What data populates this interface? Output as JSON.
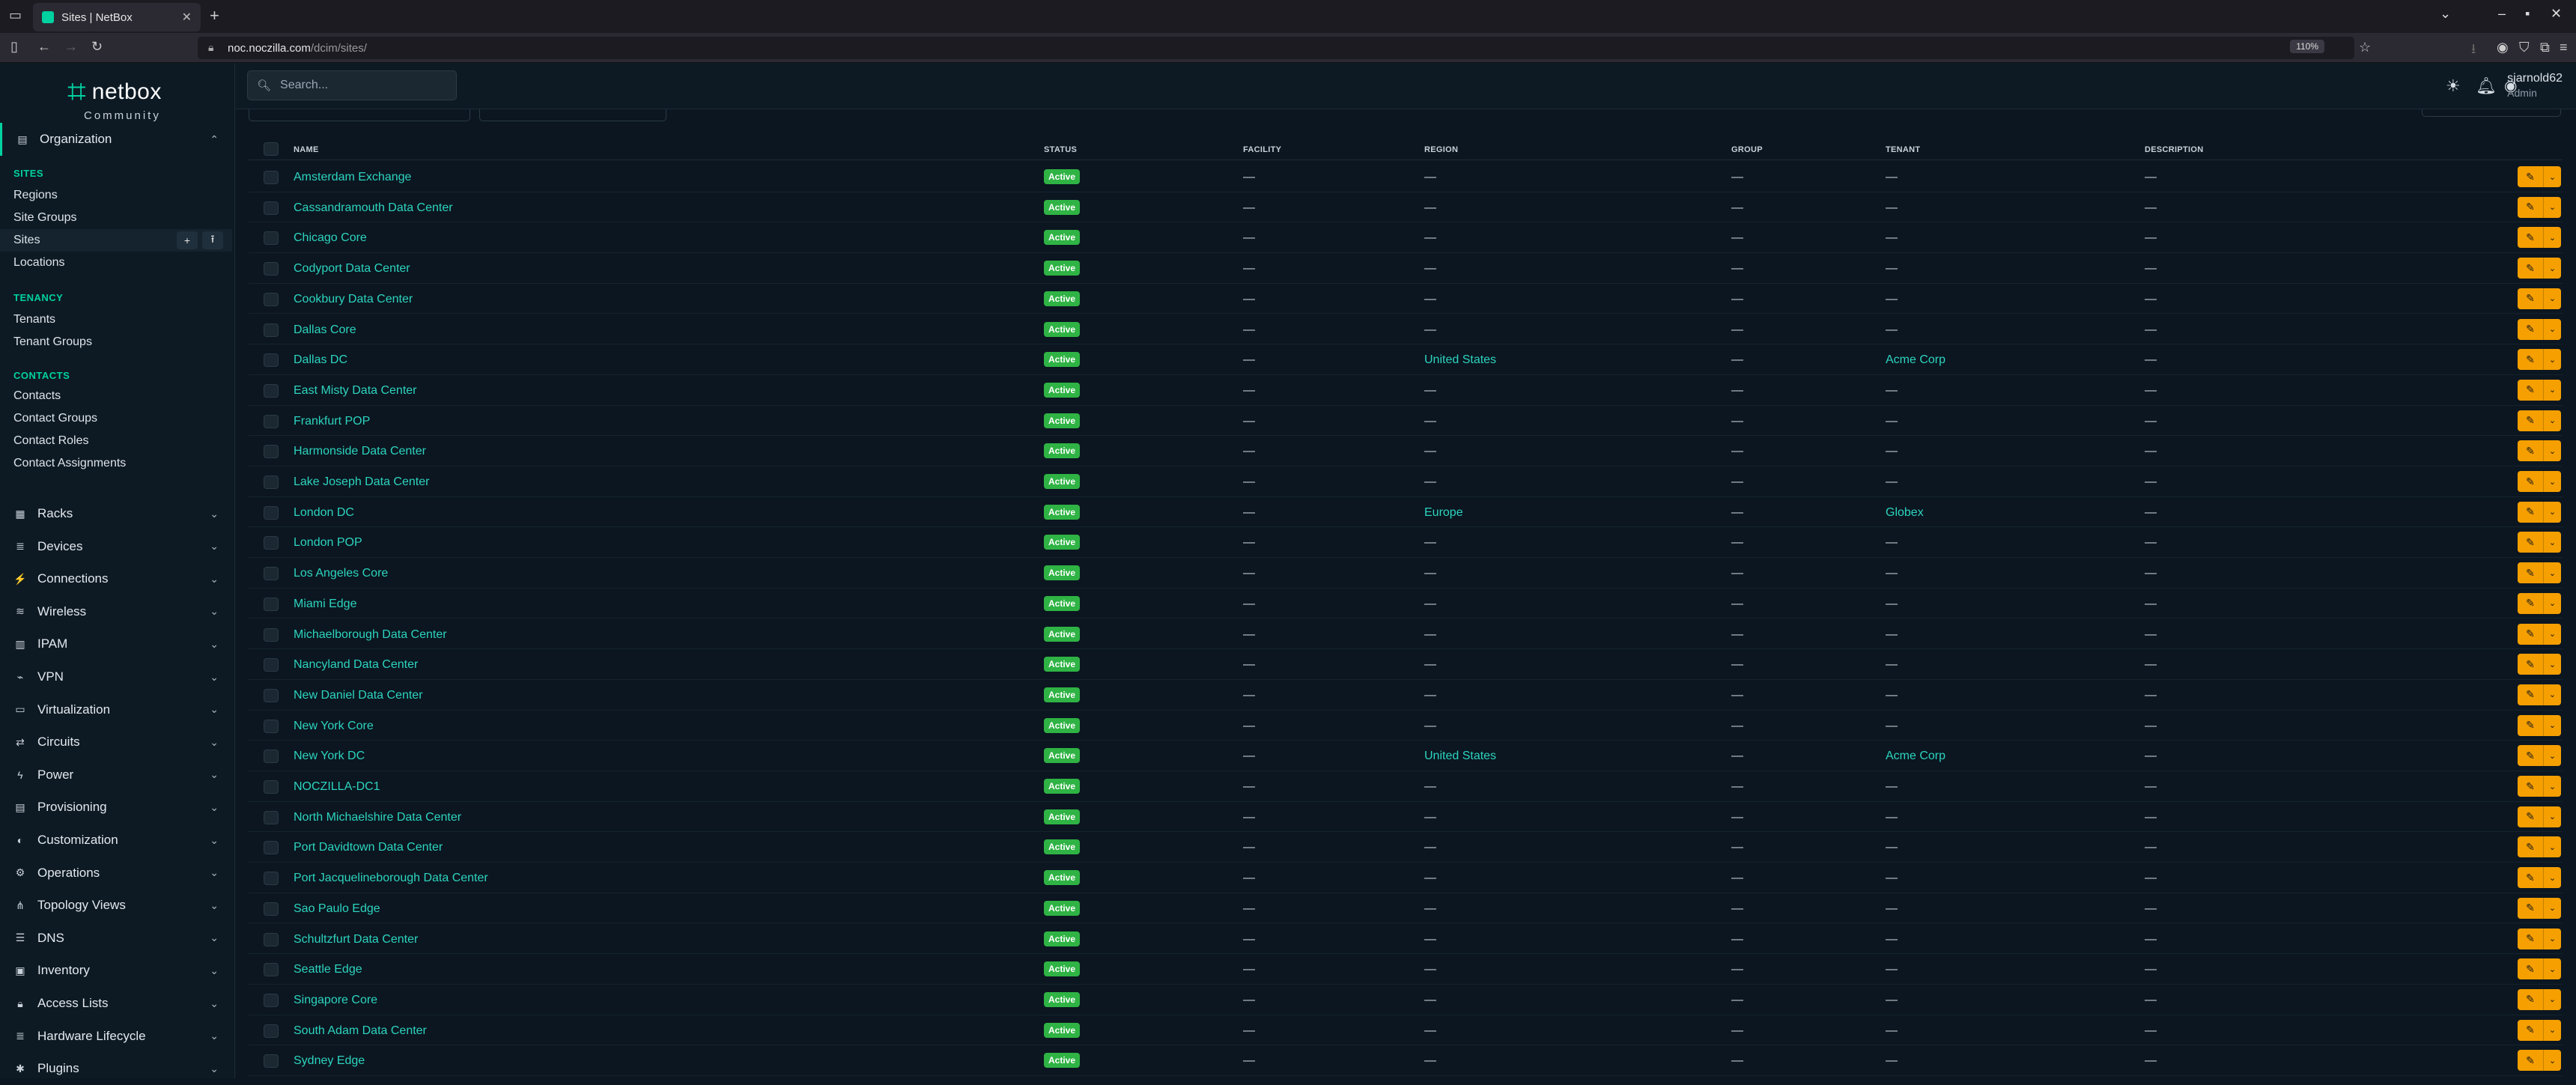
{
  "browser": {
    "tab_title": "Sites | NetBox",
    "url_host": "noc.noczilla.com",
    "url_path": "/dcim/sites/",
    "zoom": "110%"
  },
  "brand": {
    "name": "netbox",
    "edition": "Community"
  },
  "search": {
    "placeholder": "Search..."
  },
  "user": {
    "username": "sjarnold62",
    "role": "Admin"
  },
  "sidebar": {
    "organization": "Organization",
    "groups": [
      {
        "heading": "SITES",
        "items": [
          "Regions",
          "Site Groups",
          "Sites",
          "Locations"
        ]
      },
      {
        "heading": "TENANCY",
        "items": [
          "Tenants",
          "Tenant Groups"
        ]
      },
      {
        "heading": "CONTACTS",
        "items": [
          "Contacts",
          "Contact Groups",
          "Contact Roles",
          "Contact Assignments"
        ]
      }
    ],
    "selected_add": "+",
    "selected_import": "⭱",
    "sections": [
      {
        "label": "Racks",
        "icon": "rack-icon"
      },
      {
        "label": "Devices",
        "icon": "server-icon"
      },
      {
        "label": "Connections",
        "icon": "plug-icon"
      },
      {
        "label": "Wireless",
        "icon": "wifi-icon"
      },
      {
        "label": "IPAM",
        "icon": "counter-icon"
      },
      {
        "label": "VPN",
        "icon": "tunnel-icon"
      },
      {
        "label": "Virtualization",
        "icon": "monitor-icon"
      },
      {
        "label": "Circuits",
        "icon": "transit-icon"
      },
      {
        "label": "Power",
        "icon": "power-icon"
      },
      {
        "label": "Provisioning",
        "icon": "file-icon"
      },
      {
        "label": "Customization",
        "icon": "palette-icon"
      },
      {
        "label": "Operations",
        "icon": "cogs-icon"
      },
      {
        "label": "Topology Views",
        "icon": "topology-icon"
      },
      {
        "label": "DNS",
        "icon": "dns-icon"
      },
      {
        "label": "Inventory",
        "icon": "inventory-icon"
      },
      {
        "label": "Access Lists",
        "icon": "lock-icon"
      },
      {
        "label": "Hardware Lifecycle",
        "icon": "list-icon"
      },
      {
        "label": "Plugins",
        "icon": "puzzle-icon"
      }
    ]
  },
  "table": {
    "columns": [
      "NAME",
      "STATUS",
      "FACILITY",
      "REGION",
      "GROUP",
      "TENANT",
      "DESCRIPTION"
    ],
    "empty": "—",
    "rows": [
      {
        "name": "Amsterdam Exchange",
        "status": "Active",
        "region": "—",
        "tenant": "—"
      },
      {
        "name": "Cassandramouth Data Center",
        "status": "Active",
        "region": "—",
        "tenant": "—"
      },
      {
        "name": "Chicago Core",
        "status": "Active",
        "region": "—",
        "tenant": "—"
      },
      {
        "name": "Codyport Data Center",
        "status": "Active",
        "region": "—",
        "tenant": "—"
      },
      {
        "name": "Cookbury Data Center",
        "status": "Active",
        "region": "—",
        "tenant": "—"
      },
      {
        "name": "Dallas Core",
        "status": "Active",
        "region": "—",
        "tenant": "—"
      },
      {
        "name": "Dallas DC",
        "status": "Active",
        "region": "United States",
        "tenant": "Acme Corp"
      },
      {
        "name": "East Misty Data Center",
        "status": "Active",
        "region": "—",
        "tenant": "—"
      },
      {
        "name": "Frankfurt POP",
        "status": "Active",
        "region": "—",
        "tenant": "—"
      },
      {
        "name": "Harmonside Data Center",
        "status": "Active",
        "region": "—",
        "tenant": "—"
      },
      {
        "name": "Lake Joseph Data Center",
        "status": "Active",
        "region": "—",
        "tenant": "—"
      },
      {
        "name": "London DC",
        "status": "Active",
        "region": "Europe",
        "tenant": "Globex"
      },
      {
        "name": "London POP",
        "status": "Active",
        "region": "—",
        "tenant": "—"
      },
      {
        "name": "Los Angeles Core",
        "status": "Active",
        "region": "—",
        "tenant": "—"
      },
      {
        "name": "Miami Edge",
        "status": "Active",
        "region": "—",
        "tenant": "—"
      },
      {
        "name": "Michaelborough Data Center",
        "status": "Active",
        "region": "—",
        "tenant": "—"
      },
      {
        "name": "Nancyland Data Center",
        "status": "Active",
        "region": "—",
        "tenant": "—"
      },
      {
        "name": "New Daniel Data Center",
        "status": "Active",
        "region": "—",
        "tenant": "—"
      },
      {
        "name": "New York Core",
        "status": "Active",
        "region": "—",
        "tenant": "—"
      },
      {
        "name": "New York DC",
        "status": "Active",
        "region": "United States",
        "tenant": "Acme Corp"
      },
      {
        "name": "NOCZILLA-DC1",
        "status": "Active",
        "region": "—",
        "tenant": "—"
      },
      {
        "name": "North Michaelshire Data Center",
        "status": "Active",
        "region": "—",
        "tenant": "—"
      },
      {
        "name": "Port Davidtown Data Center",
        "status": "Active",
        "region": "—",
        "tenant": "—"
      },
      {
        "name": "Port Jacquelineborough Data Center",
        "status": "Active",
        "region": "—",
        "tenant": "—"
      },
      {
        "name": "Sao Paulo Edge",
        "status": "Active",
        "region": "—",
        "tenant": "—"
      },
      {
        "name": "Schultzfurt Data Center",
        "status": "Active",
        "region": "—",
        "tenant": "—"
      },
      {
        "name": "Seattle Edge",
        "status": "Active",
        "region": "—",
        "tenant": "—"
      },
      {
        "name": "Singapore Core",
        "status": "Active",
        "region": "—",
        "tenant": "—"
      },
      {
        "name": "South Adam Data Center",
        "status": "Active",
        "region": "—",
        "tenant": "—"
      },
      {
        "name": "Sydney Edge",
        "status": "Active",
        "region": "—",
        "tenant": "—"
      }
    ]
  },
  "colors": {
    "accent": "#00d1a0",
    "link": "#2dd4bf",
    "active_badge": "#2fb344",
    "action": "#f59f00",
    "background": "#0b1620"
  }
}
